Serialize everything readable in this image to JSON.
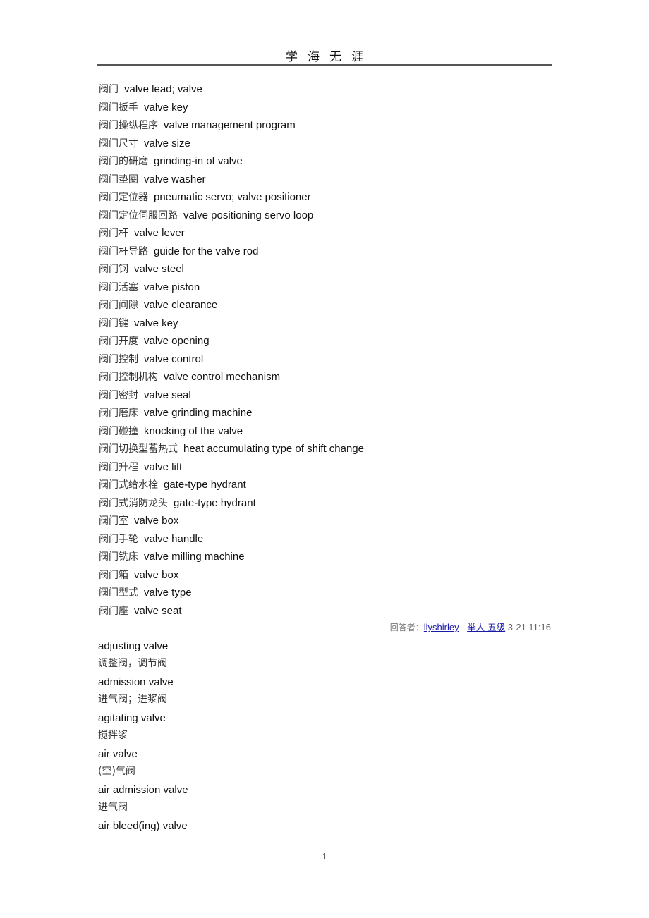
{
  "header": {
    "title": "学海无涯"
  },
  "entries": [
    {
      "zh": "阀门",
      "en": "valve lead; valve"
    },
    {
      "zh": "阀门扳手",
      "en": "valve key"
    },
    {
      "zh": "阀门操纵程序",
      "en": "valve management program"
    },
    {
      "zh": "阀门尺寸",
      "en": "valve size"
    },
    {
      "zh": "阀门的研磨",
      "en": "grinding-in of valve"
    },
    {
      "zh": "阀门垫圈",
      "en": "valve washer"
    },
    {
      "zh": "阀门定位器",
      "en": "pneumatic servo; valve positioner"
    },
    {
      "zh": "阀门定位伺服回路",
      "en": "valve positioning servo loop"
    },
    {
      "zh": "阀门杆",
      "en": "valve lever"
    },
    {
      "zh": "阀门杆导路",
      "en": "guide for the valve rod"
    },
    {
      "zh": "阀门钢",
      "en": "valve steel"
    },
    {
      "zh": "阀门活塞",
      "en": "valve piston"
    },
    {
      "zh": "阀门间隙",
      "en": "valve clearance"
    },
    {
      "zh": "阀门键",
      "en": "valve key"
    },
    {
      "zh": "阀门开度",
      "en": "valve opening"
    },
    {
      "zh": "阀门控制",
      "en": "valve control"
    },
    {
      "zh": "阀门控制机构",
      "en": "valve control mechanism"
    },
    {
      "zh": "阀门密封",
      "en": "valve seal"
    },
    {
      "zh": "阀门磨床",
      "en": "valve grinding machine"
    },
    {
      "zh": "阀门碰撞",
      "en": "knocking of the valve"
    },
    {
      "zh": "阀门切换型蓄热式",
      "en": "heat accumulating type of shift change"
    },
    {
      "zh": "阀门升程",
      "en": "valve lift"
    },
    {
      "zh": "阀门式给水栓",
      "en": "gate-type hydrant"
    },
    {
      "zh": "阀门式消防龙头",
      "en": "gate-type hydrant"
    },
    {
      "zh": "阀门室",
      "en": "valve box"
    },
    {
      "zh": "阀门手轮",
      "en": "valve handle"
    },
    {
      "zh": "阀门铣床",
      "en": "valve milling machine"
    },
    {
      "zh": "阀门箱",
      "en": "valve box"
    },
    {
      "zh": "阀门型式",
      "en": "valve type"
    },
    {
      "zh": "阀门座",
      "en": "valve seat"
    }
  ],
  "answer": {
    "label": "回答者：",
    "user": "llyshirley",
    "separator": " - ",
    "level": "举人 五级",
    "time": "3-21 11:16"
  },
  "glossary": [
    {
      "en": "adjusting valve",
      "zh": "调整阀，调节阀"
    },
    {
      "en": "admission valve",
      "zh": "进气阀；进浆阀"
    },
    {
      "en": "agitating valve",
      "zh": "搅拌浆"
    },
    {
      "en": "air valve",
      "zh": "(空)气阀"
    },
    {
      "en": "air admission valve",
      "zh": "进气阀"
    },
    {
      "en": "air bleed(ing) valve",
      "zh": null
    }
  ],
  "footer": {
    "page_number": "1"
  },
  "colors": {
    "link": "#1a1aa6",
    "meta_text": "#777777",
    "rule": "#555555"
  }
}
